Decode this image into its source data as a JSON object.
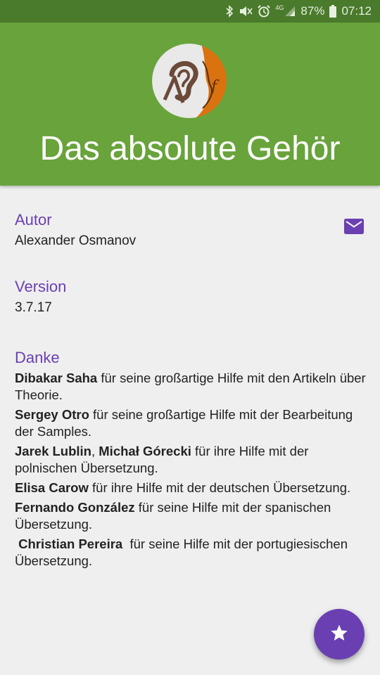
{
  "status_bar": {
    "network": "4G",
    "battery": "87%",
    "time": "07:12",
    "icons": [
      "bluetooth-icon",
      "mute-icon",
      "alarm-icon",
      "signal-icon",
      "battery-icon"
    ]
  },
  "header": {
    "title": "Das absolute Gehör",
    "logo": "ear-violin-logo"
  },
  "author": {
    "label": "Autor",
    "value": "Alexander Osmanov",
    "contact_icon": "mail-icon"
  },
  "version": {
    "label": "Version",
    "value": "3.7.17"
  },
  "thanks": {
    "label": "Danke",
    "items": [
      {
        "names": [
          "Dibakar Saha"
        ],
        "text": " für seine großartige Hilfe mit den Artikeln über Theorie."
      },
      {
        "names": [
          "Sergey Otro"
        ],
        "text": " für seine großartige Hilfe mit der Bearbeitung der Samples."
      },
      {
        "names": [
          "Jarek Lublin",
          "Michał Górecki"
        ],
        "separator": ", ",
        "text": " für ihre Hilfe mit der polnischen Übersetzung."
      },
      {
        "names": [
          "Elisa Carow"
        ],
        "text": " für ihre Hilfe mit der deutschen Übersetzung."
      },
      {
        "names": [
          "Fernando González"
        ],
        "text": " für seine Hilfe mit der spanischen Übersetzung."
      },
      {
        "names": [
          "Christian Pereira"
        ],
        "text": "  für seine Hilfe mit der portugiesischen Übersetzung.",
        "lead": " "
      }
    ]
  },
  "fab": {
    "icon": "star-icon"
  },
  "colors": {
    "status_bar": "#4a7a2b",
    "header": "#68a33b",
    "accent": "#6a3fb2",
    "background": "#efefef"
  }
}
